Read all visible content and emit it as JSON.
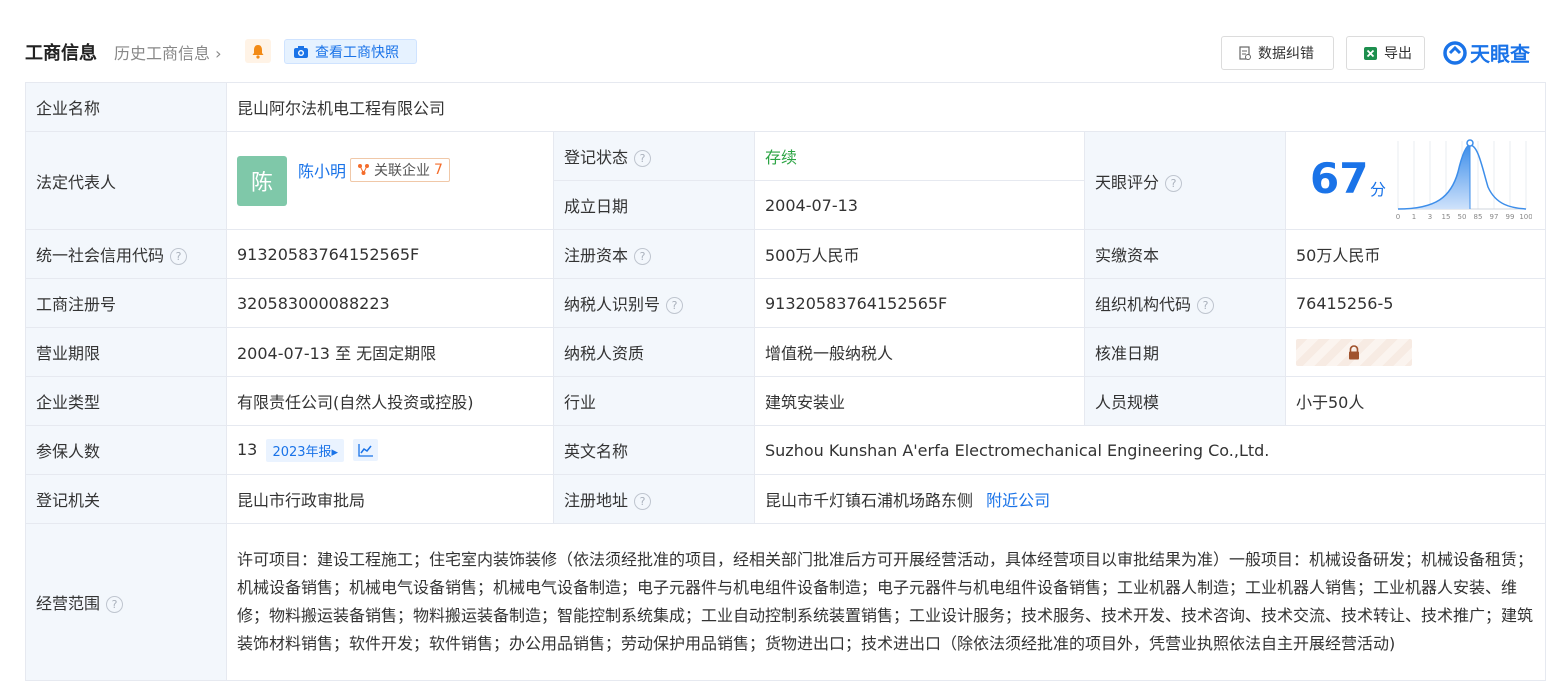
{
  "header": {
    "title": "工商信息",
    "history": "历史工商信息",
    "snapshot": "查看工商快照",
    "fix_btn": "数据纠错",
    "export_btn": "导出",
    "logo": "天眼查",
    "accent": "#1a73e8"
  },
  "company": {
    "name_label": "企业名称",
    "name": "昆山阿尔法机电工程有限公司",
    "legal_label": "法定代表人",
    "avatar_char": "陈",
    "legal_name": "陈小明",
    "related_label": "关联企业",
    "related_count": "7",
    "reg_status_label": "登记状态",
    "reg_status": "存续",
    "found_label": "成立日期",
    "found_date": "2004-07-13",
    "score_label": "天眼评分",
    "score": "67",
    "score_unit": "分",
    "score_axis": [
      "0",
      "1",
      "3",
      "15",
      "50",
      "85",
      "97",
      "99",
      "100"
    ],
    "credit_label": "统一社会信用代码",
    "credit_code": "91320583764152565F",
    "reg_capital_label": "注册资本",
    "reg_capital": "500万人民币",
    "paid_capital_label": "实缴资本",
    "paid_capital": "50万人民币",
    "reg_no_label": "工商注册号",
    "reg_no": "320583000088223",
    "tax_id_label": "纳税人识别号",
    "tax_id": "91320583764152565F",
    "org_code_label": "组织机构代码",
    "org_code": "76415256-5",
    "term_label": "营业期限",
    "term": "2004-07-13 至 无固定期限",
    "tax_qual_label": "纳税人资质",
    "tax_qual": "增值税一般纳税人",
    "approve_label": "核准日期",
    "type_label": "企业类型",
    "type": "有限责任公司(自然人投资或控股)",
    "industry_label": "行业",
    "industry": "建筑安装业",
    "staff_label": "人员规模",
    "staff": "小于50人",
    "insured_label": "参保人数",
    "insured": "13",
    "year_report": "2023年报",
    "en_name_label": "英文名称",
    "en_name": "Suzhou Kunshan A'erfa Electromechanical Engineering Co.,Ltd.",
    "authority_label": "登记机关",
    "authority": "昆山市行政审批局",
    "address_label": "注册地址",
    "address": "昆山市千灯镇石浦机场路东侧",
    "nearby": "附近公司",
    "scope_label": "经营范围",
    "scope": "许可项目：建设工程施工；住宅室内装饰装修（依法须经批准的项目，经相关部门批准后方可开展经营活动，具体经营项目以审批结果为准）一般项目：机械设备研发；机械设备租赁；机械设备销售；机械电气设备销售；机械电气设备制造；电子元器件与机电组件设备制造；电子元器件与机电组件设备销售；工业机器人制造；工业机器人销售；工业机器人安装、维修；物料搬运装备销售；物料搬运装备制造；智能控制系统集成；工业自动控制系统装置销售；工业设计服务；技术服务、技术开发、技术咨询、技术交流、技术转让、技术推广；建筑装饰材料销售；软件开发；软件销售；办公用品销售；劳动保护用品销售；货物进出口；技术进出口（除依法须经批准的项目外，凭营业执照依法自主开展经营活动)"
  }
}
